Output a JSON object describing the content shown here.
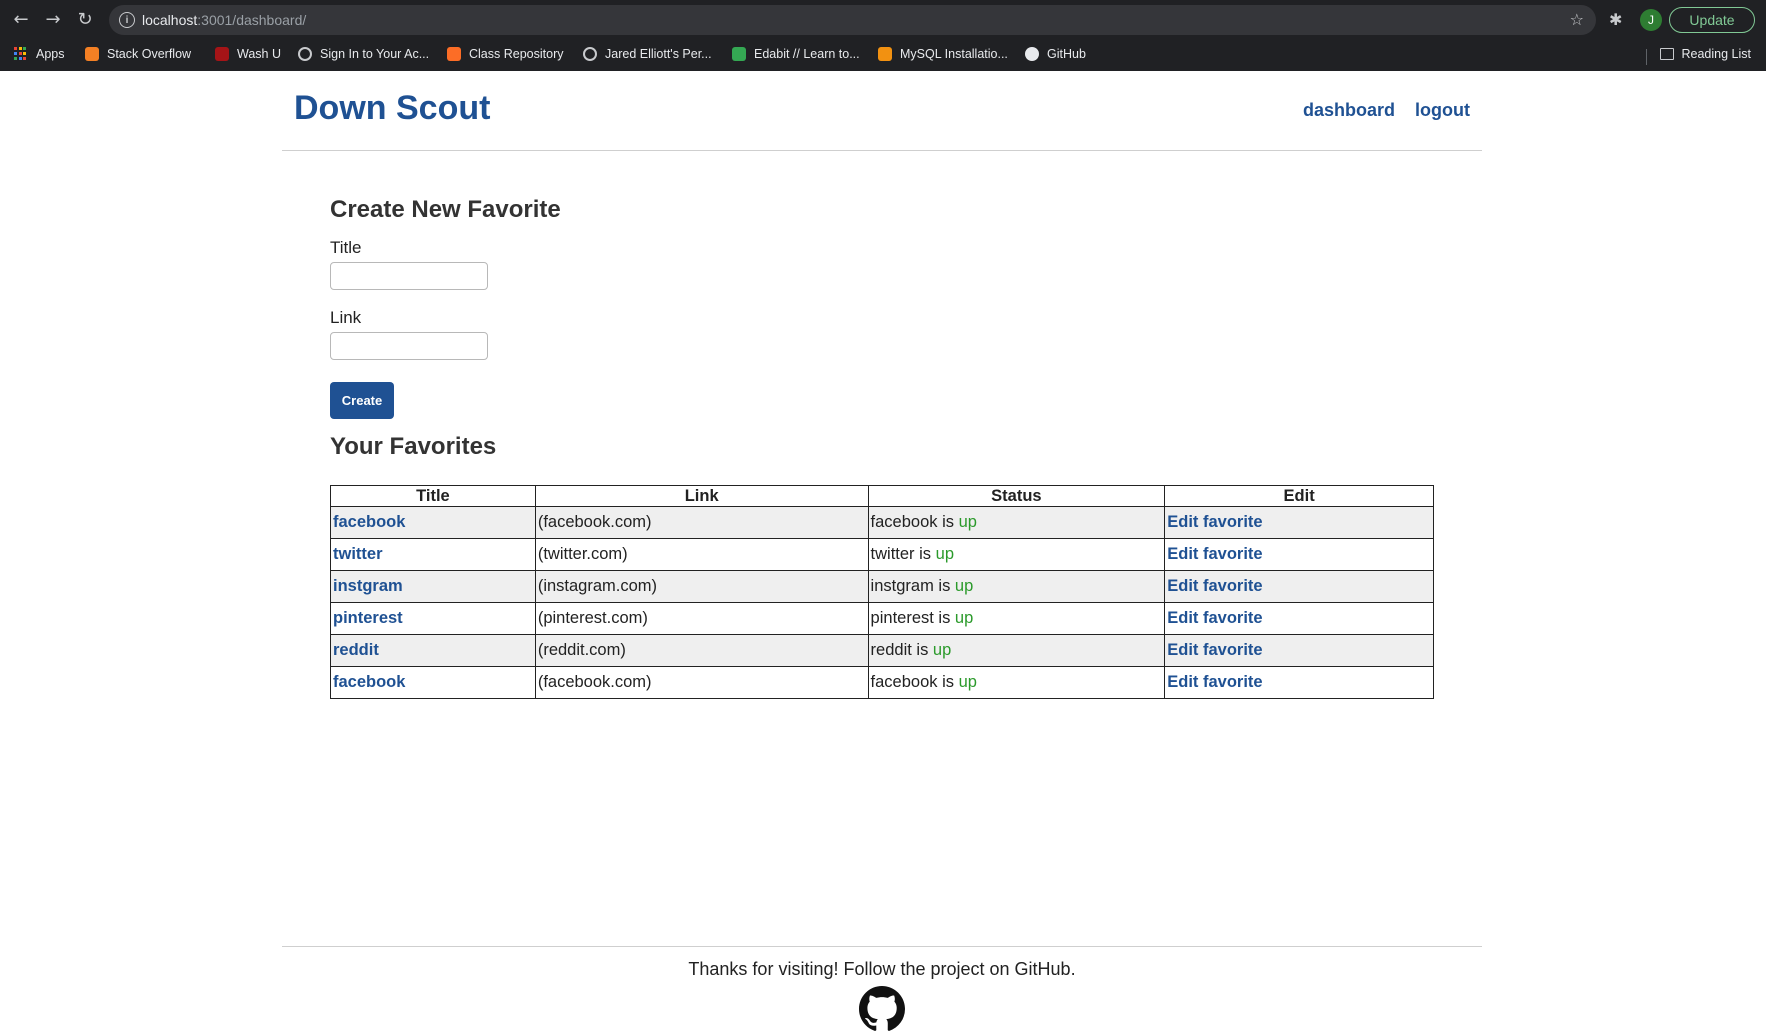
{
  "browser": {
    "url_host": "localhost",
    "url_path": ":3001/dashboard/",
    "update_label": "Update",
    "profile_initial": "J",
    "reading_list": "Reading List",
    "bookmarks": [
      {
        "label": "Apps",
        "icon": "apps-icon"
      },
      {
        "label": "Stack Overflow",
        "icon": "stackoverflow-icon"
      },
      {
        "label": "Wash U",
        "icon": "washu-icon"
      },
      {
        "label": "Sign In to Your Ac...",
        "icon": "globe-icon"
      },
      {
        "label": "Class Repository",
        "icon": "gitlab-icon"
      },
      {
        "label": "Jared Elliott's Per...",
        "icon": "globe-icon"
      },
      {
        "label": "Edabit // Learn to...",
        "icon": "edabit-icon"
      },
      {
        "label": "MySQL Installatio...",
        "icon": "mysql-icon"
      },
      {
        "label": "GitHub",
        "icon": "github-icon"
      }
    ]
  },
  "header": {
    "brand": "Down Scout",
    "nav": [
      "dashboard",
      "logout"
    ]
  },
  "create_form": {
    "heading": "Create New Favorite",
    "title_label": "Title",
    "title_value": "",
    "link_label": "Link",
    "link_value": "",
    "submit_label": "Create"
  },
  "favorites": {
    "heading": "Your Favorites",
    "columns": [
      "Title",
      "Link",
      "Status",
      "Edit"
    ],
    "rows": [
      {
        "title": "facebook",
        "link": "(facebook.com)",
        "status_prefix": "facebook is ",
        "status": "up",
        "edit": "Edit favorite"
      },
      {
        "title": "twitter",
        "link": "(twitter.com)",
        "status_prefix": "twitter is ",
        "status": "up",
        "edit": "Edit favorite"
      },
      {
        "title": "instgram",
        "link": "(instagram.com)",
        "status_prefix": "instgram is ",
        "status": "up",
        "edit": "Edit favorite"
      },
      {
        "title": "pinterest",
        "link": "(pinterest.com)",
        "status_prefix": "pinterest is ",
        "status": "up",
        "edit": "Edit favorite"
      },
      {
        "title": "reddit",
        "link": "(reddit.com)",
        "status_prefix": "reddit is ",
        "status": "up",
        "edit": "Edit favorite"
      },
      {
        "title": "facebook",
        "link": "(facebook.com)",
        "status_prefix": "facebook is ",
        "status": "up",
        "edit": "Edit favorite"
      }
    ]
  },
  "footer": {
    "text": "Thanks for visiting! Follow the project on GitHub."
  },
  "colors": {
    "brand": "#1f5193",
    "status_up": "#2b9a2b",
    "row_alt": "#efefef"
  }
}
